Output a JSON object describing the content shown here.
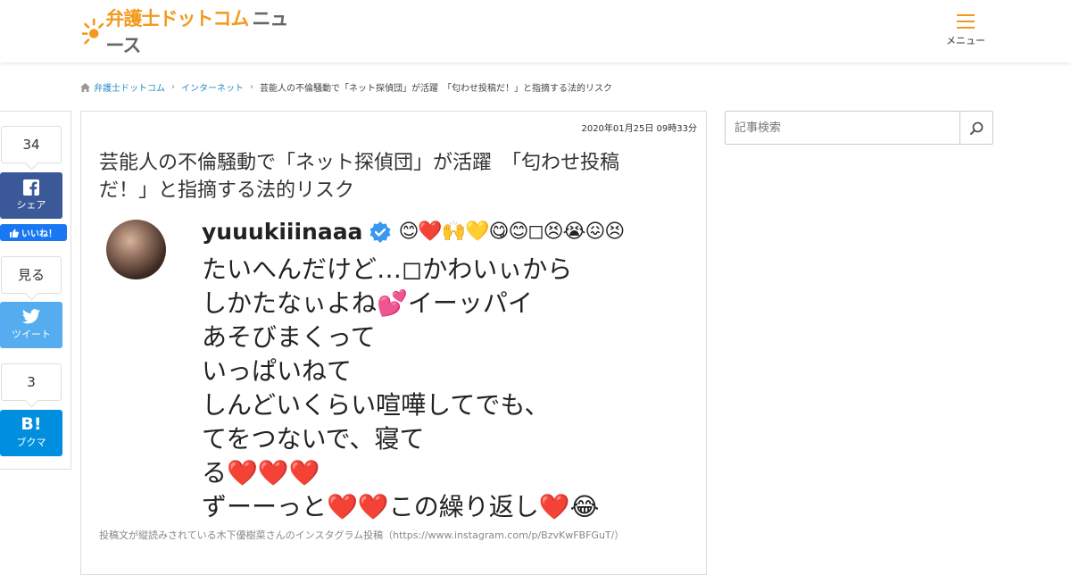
{
  "header": {
    "logo_main": "弁護士ドットコム",
    "logo_sub": "ニュース",
    "menu_label": "メニュー"
  },
  "breadcrumb": {
    "items": [
      "弁護士ドットコム",
      "インターネット"
    ],
    "current": "芸能人の不倫騒動で「ネット探偵団」が活躍　「匂わせ投稿だ！」と指摘する法的リスク"
  },
  "share": {
    "facebook_count": "34",
    "facebook_label": "シェア",
    "like_label": "いいね！",
    "twitter_count": "見る",
    "twitter_label": "ツイート",
    "hatena_count": "3",
    "hatena_label": "ブクマ"
  },
  "article": {
    "date": "2020年01月25日 09時33分",
    "title": "芸能人の不倫騒動で「ネット探偵団」が活躍　「匂わせ投稿だ！」と指摘する法的リスク",
    "post": {
      "username": "yuuukiiinaaa",
      "emojis": "😊❤️🙌💛😋😊◻😣😭😖😣",
      "lines": [
        "たいへんだけど…◻かわいぃから",
        "しかたなぃよね💕イーッパイ",
        "あそびまくって",
        "いっぱいねて",
        "しんどいくらい喧嘩してでも、",
        "てをつないで、寝て",
        "る❤️❤️❤️",
        "ずーーっと❤️❤️この繰り返し❤️😂"
      ]
    },
    "caption": "投稿文が縦読みされている木下優樹菜さんのインスタグラム投稿（https://www.instagram.com/p/BzvKwFBFGuT/）"
  },
  "search": {
    "placeholder": "記事検索"
  },
  "colors": {
    "brand_orange": "#f39a1e",
    "facebook": "#3b5998",
    "twitter": "#55acee",
    "hatena": "#008fde",
    "link": "#2a8bc7"
  }
}
